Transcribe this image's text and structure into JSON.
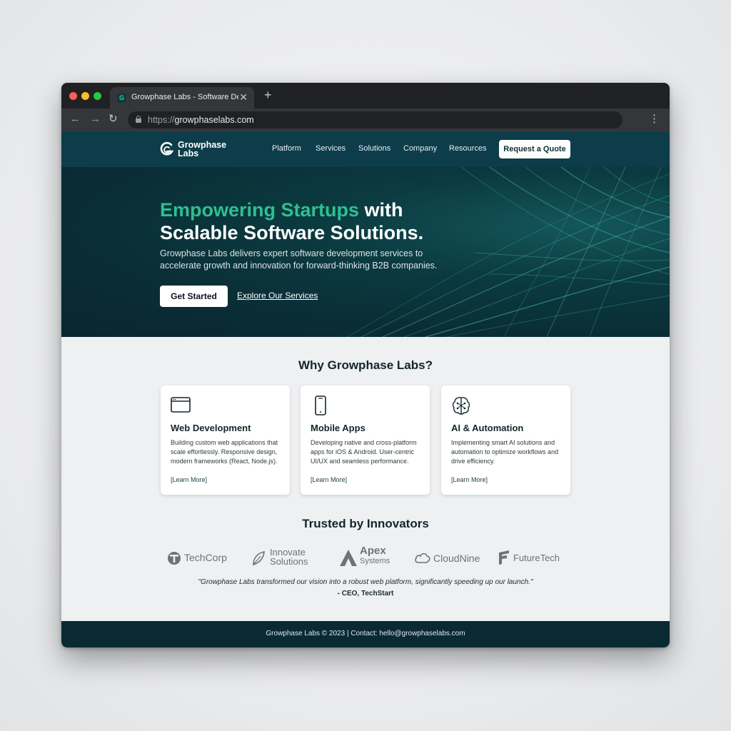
{
  "browser": {
    "tab_title": "Growphase Labs - Software De",
    "tab_close": "✕",
    "new_tab": "+",
    "url_scheme": "https://",
    "url_host": "growphaselabs.com",
    "back": "←",
    "forward": "→",
    "reload": "↻",
    "menu": "⋮"
  },
  "nav": {
    "logo_line1": "Growphase",
    "logo_line2": "Labs",
    "links": [
      "Platform",
      "Services",
      "Solutions",
      "Company",
      "Resources"
    ],
    "cta": "Request a Quote"
  },
  "hero": {
    "title_accent": "Empowering Startups",
    "title_rest_1": " with",
    "title_line2": "Scalable Software Solutions.",
    "subtitle": "Growphase Labs delivers expert software development services to accelerate growth and innovation for forward-thinking B2B companies.",
    "primary_cta": "Get Started",
    "secondary_cta": "Explore Our Services"
  },
  "why": {
    "title": "Why Growphase Labs?",
    "cards": [
      {
        "icon": "browser-window-icon",
        "title": "Web Development",
        "desc": "Building custom web applications that scale effortlessly. Responsive design, modern frameworks (React, Node.js).",
        "link": "[Learn More]"
      },
      {
        "icon": "smartphone-icon",
        "title": "Mobile Apps",
        "desc": "Developing native and cross-platform apps for iOS & Android. User-centric UI/UX and seamless performance.",
        "link": "[Learn More]"
      },
      {
        "icon": "ai-brain-icon",
        "title": "AI & Automation",
        "desc": "Implementing smart AI solutions and automation to optimize workflows and drive efficiency.",
        "link": "[Learn More]"
      }
    ]
  },
  "trusted": {
    "title": "Trusted by Innovators",
    "brands": [
      {
        "name": "TechCorp",
        "icon": "techcorp-logo-icon"
      },
      {
        "name": "Innovate",
        "name2": "Solutions",
        "icon": "leaf-logo-icon"
      },
      {
        "name": "Apex",
        "name2": "Systems",
        "icon": "apex-logo-icon"
      },
      {
        "name": "CloudNine",
        "icon": "cloud-logo-icon"
      },
      {
        "name": "FutureTech",
        "icon": "futuretech-logo-icon"
      }
    ],
    "quote": "\"Growphase Labs transformed our vision into a robust web platform, significantly speeding up our launch.\"",
    "quote_author": "- CEO, TechStart"
  },
  "footer": {
    "text": "Growphase Labs © 2023 | Contact: hello@growphaselabs.com"
  },
  "colors": {
    "accent": "#2fbf8f",
    "nav_bg": "#0d3d4a",
    "hero_bg": "#0a2d35",
    "footer_bg": "#0a2a33"
  }
}
